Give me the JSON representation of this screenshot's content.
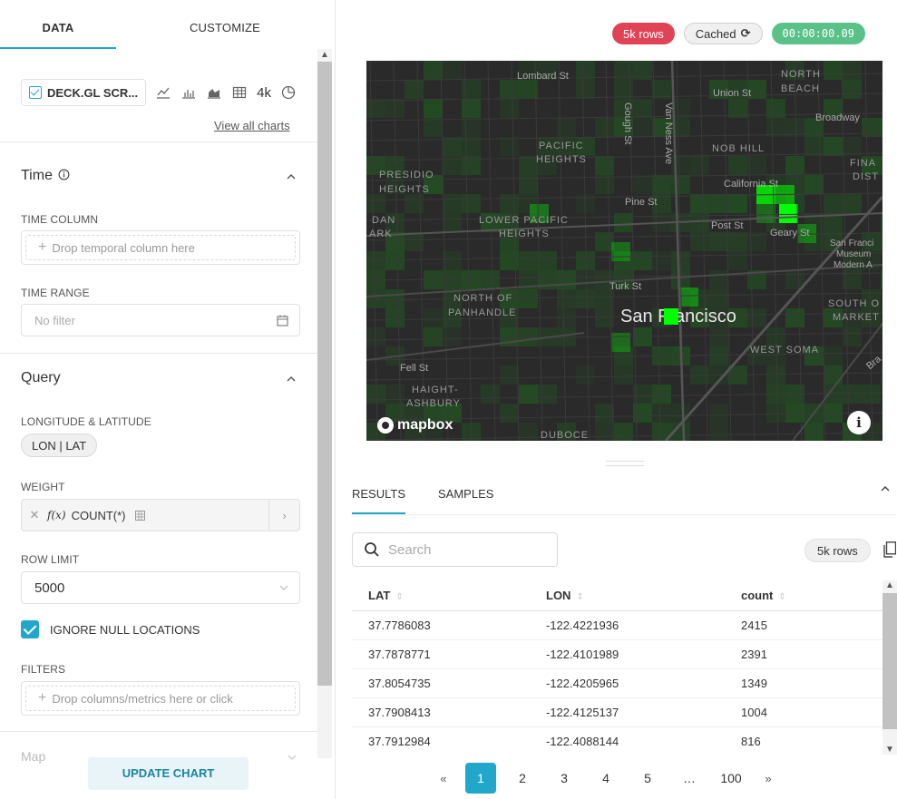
{
  "tabs": {
    "data": "DATA",
    "customize": "CUSTOMIZE"
  },
  "viz": {
    "name": "DECK.GL SCR...",
    "grid_text": "4k",
    "view_all": "View all charts"
  },
  "time": {
    "title": "Time",
    "column_label": "TIME COLUMN",
    "column_placeholder": "Drop temporal column here",
    "range_label": "TIME RANGE",
    "range_value": "No filter"
  },
  "query": {
    "title": "Query",
    "lonlat_label": "LONGITUDE & LATITUDE",
    "lonlat_value": "LON | LAT",
    "weight_label": "WEIGHT",
    "weight_fx": "f(x)",
    "weight_value": "COUNT(*)",
    "row_limit_label": "ROW LIMIT",
    "row_limit_value": "5000",
    "ignore_null_label": "IGNORE NULL LOCATIONS",
    "ignore_null_checked": true,
    "filters_label": "FILTERS",
    "filters_placeholder": "Drop columns/metrics here or click"
  },
  "map_section": "Map",
  "update_button": "UPDATE CHART",
  "badges": {
    "rows": "5k rows",
    "cached": "Cached",
    "timer": "00:00:00.09"
  },
  "map": {
    "labels": [
      "Lombard St",
      "Union St",
      "NORTH",
      "BEACH",
      "Broadway",
      "Gough St",
      "Van Ness Ave",
      "PACIFIC",
      "HEIGHTS",
      "NOB HILL",
      "PRESIDIO",
      "HEIGHTS",
      "FINA",
      "DIST",
      "California St",
      "Pine St",
      "LOWER PACIFIC",
      "HEIGHTS",
      "DAN",
      "ARK",
      "Post St",
      "Geary St",
      "San Franci",
      "Museum",
      "Modern A",
      "Turk St",
      "NORTH OF",
      "PANHANDLE",
      "SOUTH O",
      "MARKET",
      "San Francisco",
      "WEST SOMA",
      "Fell St",
      "HAIGHT-",
      "ASHBURY",
      "DUBOCE",
      "Bra"
    ],
    "logo": "mapbox",
    "info": "i"
  },
  "results": {
    "tab_results": "RESULTS",
    "tab_samples": "SAMPLES",
    "search_placeholder": "Search",
    "rows_pill": "5k rows",
    "columns": [
      "LAT",
      "LON",
      "count"
    ],
    "rows": [
      [
        "37.7786083",
        "-122.4221936",
        "2415"
      ],
      [
        "37.7878771",
        "-122.4101989",
        "2391"
      ],
      [
        "37.8054735",
        "-122.4205965",
        "1349"
      ],
      [
        "37.7908413",
        "-122.4125137",
        "1004"
      ],
      [
        "37.7912984",
        "-122.4088144",
        "816"
      ]
    ]
  },
  "pagination": {
    "prev": "«",
    "pages": [
      "1",
      "2",
      "3",
      "4",
      "5",
      "…",
      "100"
    ],
    "next": "»",
    "active": "1"
  },
  "colors": {
    "accent": "#20a7c9",
    "rows_badge": "#e04355",
    "timer_badge": "#5ac189",
    "heat": "#00ff00"
  }
}
